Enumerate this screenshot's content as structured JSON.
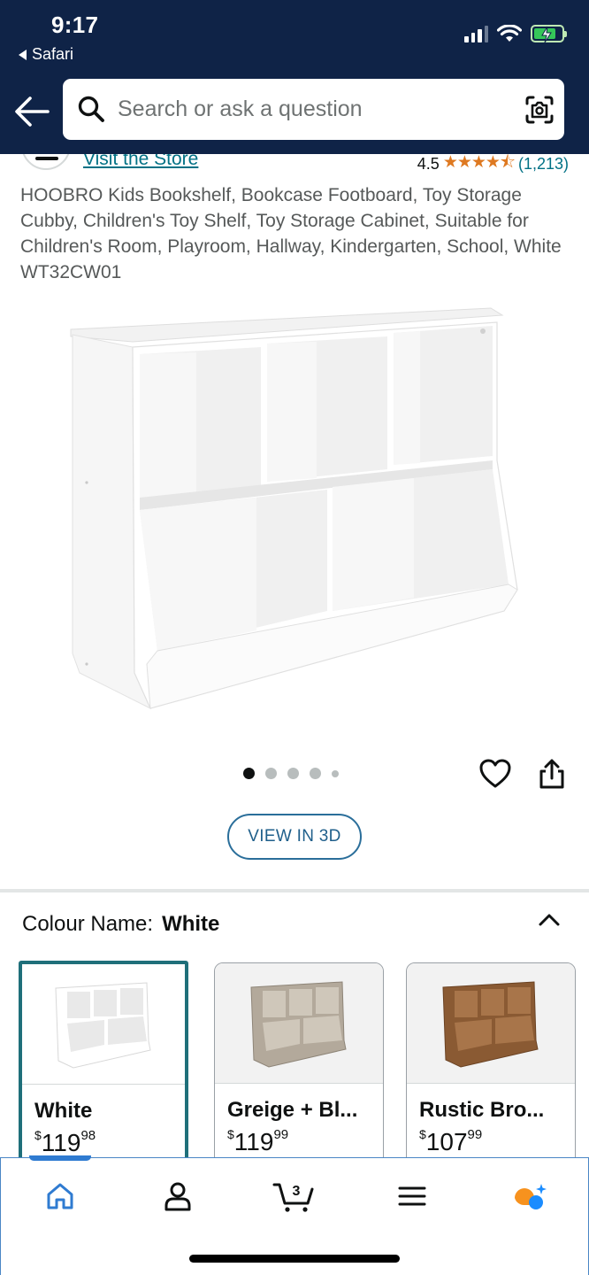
{
  "status_bar": {
    "time": "9:17",
    "back_app": "Safari"
  },
  "search": {
    "placeholder": "Search or ask a question"
  },
  "store": {
    "link_text": "Visit the Store"
  },
  "rating": {
    "value": "4.5",
    "stars": "★★★★⯪",
    "count": "(1,213)"
  },
  "product": {
    "title": "HOOBRO Kids Bookshelf, Bookcase Footboard, Toy Storage Cubby, Children's Toy Shelf, Toy Storage Cabinet, Suitable for Children's Room, Playroom, Hallway, Kindergarten, School, White WT32CW01",
    "image_count": 5,
    "active_image_index": 0
  },
  "view3d_label": "VIEW IN 3D",
  "colour": {
    "label": "Colour Name:",
    "selected": "White",
    "options": [
      {
        "name": "White",
        "dollar_sign": "$",
        "whole": "119",
        "cents": "98",
        "finish": "white"
      },
      {
        "name": "Greige + Bl...",
        "dollar_sign": "$",
        "whole": "119",
        "cents": "99",
        "finish": "greige"
      },
      {
        "name": "Rustic Bro...",
        "dollar_sign": "$",
        "whole": "107",
        "cents": "99",
        "finish": "rustic"
      }
    ]
  },
  "bottom_nav": {
    "items": [
      "home",
      "account",
      "cart",
      "menu",
      "rufus"
    ],
    "cart_count": "3",
    "active": "home"
  },
  "colors": {
    "header_bg": "#0f2347",
    "link": "#007185",
    "star": "#de7921",
    "selected_border": "#1f6f7a",
    "nav_active": "#2f7bd1",
    "rufus_orange": "#f7921e",
    "rufus_blue": "#1a8cff"
  }
}
